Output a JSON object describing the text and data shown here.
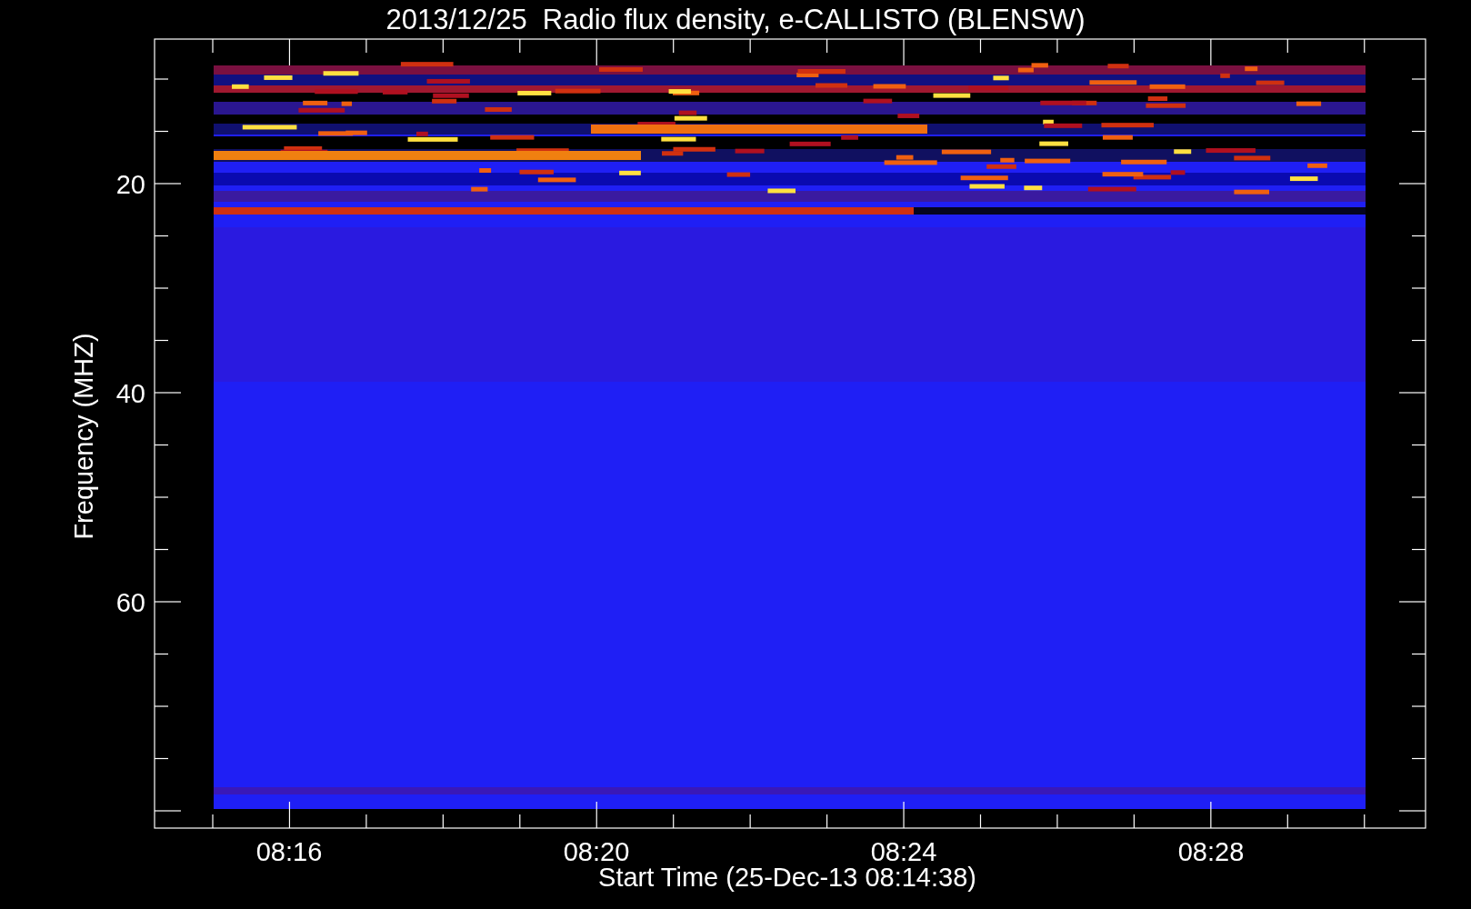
{
  "title": "2013/12/25  Radio flux density, e-CALLISTO (BLENSW)",
  "y_axis": {
    "label": "Frequency (MHZ)",
    "ticks": [
      "20",
      "40",
      "60"
    ]
  },
  "x_axis": {
    "label": "Start Time (25-Dec-13 08:14:38)",
    "ticks": [
      "08:16",
      "08:20",
      "08:24",
      "08:28"
    ]
  }
}
